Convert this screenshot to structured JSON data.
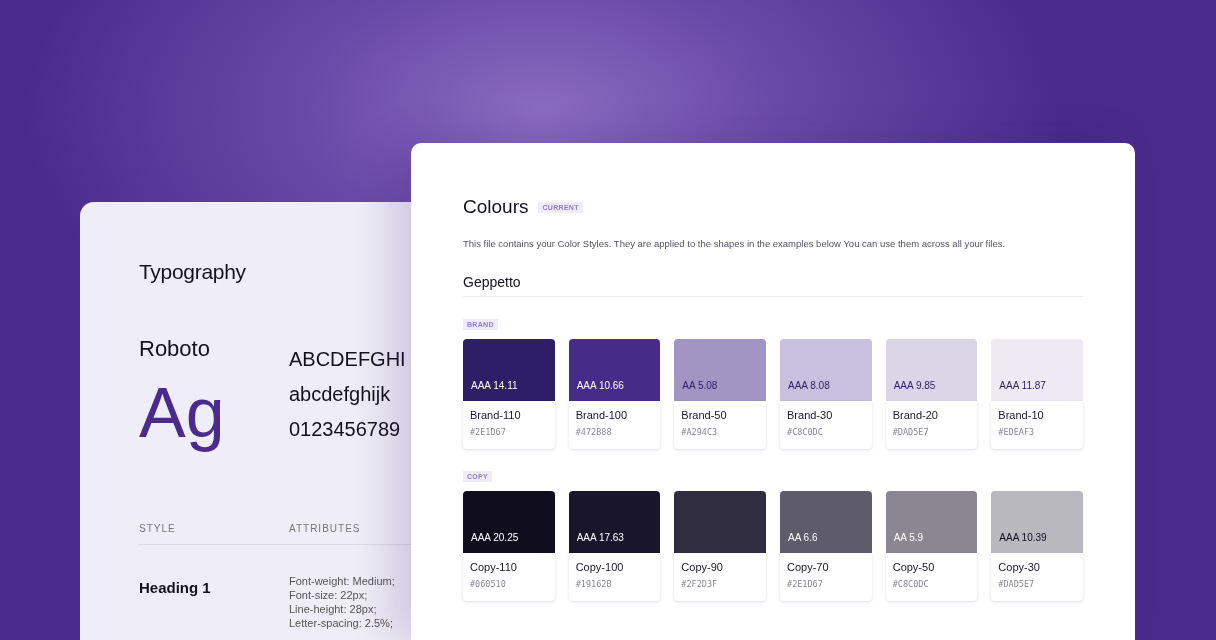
{
  "typography": {
    "title": "Typography",
    "font_name": "Roboto",
    "sample": "Ag",
    "specimen": [
      "ABCDEFGHI",
      "abcdefghijk",
      "0123456789"
    ],
    "columns": [
      "STYLE",
      "ATTRIBUTES"
    ],
    "rows": [
      {
        "style": "Heading 1",
        "attributes": [
          "Font-weight: Medium;",
          "Font-size: 22px;",
          "Line-height: 28px;",
          "Letter-spacing: 2.5%;"
        ]
      }
    ]
  },
  "colours": {
    "title": "Colours",
    "badge": "CURRENT",
    "description": "This file contains your Color Styles. They are applied to the shapes in the examples below You can use them across all your files.",
    "section": "Geppetto",
    "groups": [
      {
        "label": "BRAND",
        "swatches": [
          {
            "rating": "AAA 14.11",
            "name": "Brand-110",
            "hex": "#2E1D67",
            "color": "#2e1d67"
          },
          {
            "rating": "AAA 10.66",
            "name": "Brand-100",
            "hex": "#472B88",
            "color": "#472b88"
          },
          {
            "rating": "AA 5.08",
            "name": "Brand-50",
            "hex": "#A294C3",
            "color": "#a294c3"
          },
          {
            "rating": "AAA 8.08",
            "name": "Brand-30",
            "hex": "#C8C0DC",
            "color": "#c8c0dc"
          },
          {
            "rating": "AAA 9.85",
            "name": "Brand-20",
            "hex": "#DAD5E7",
            "color": "#dad5e7"
          },
          {
            "rating": "AAA 11.87",
            "name": "Brand-10",
            "hex": "#EDEAF3",
            "color": "#edeaf3"
          }
        ]
      },
      {
        "label": "COPY",
        "swatches": [
          {
            "rating": "AAA 20.25",
            "name": "Copy-110",
            "hex": "#060510",
            "color": "#100d1f"
          },
          {
            "rating": "AAA 17.63",
            "name": "Copy-100",
            "hex": "#19162B",
            "color": "#19162b"
          },
          {
            "name": "Copy-90",
            "hex": "#2F2D3F",
            "color": "#2f2d3f"
          },
          {
            "rating": "AA 6.6",
            "name": "Copy-70",
            "hex": "#2E1D67",
            "color": "#5e5b6b"
          },
          {
            "rating": "AA 5.9",
            "name": "Copy-50",
            "hex": "#C8C0DC",
            "color": "#8a8792"
          },
          {
            "rating": "AAA 10.39",
            "name": "Copy-30",
            "hex": "#DAD5E7",
            "color": "#bab8bf"
          }
        ]
      }
    ]
  }
}
